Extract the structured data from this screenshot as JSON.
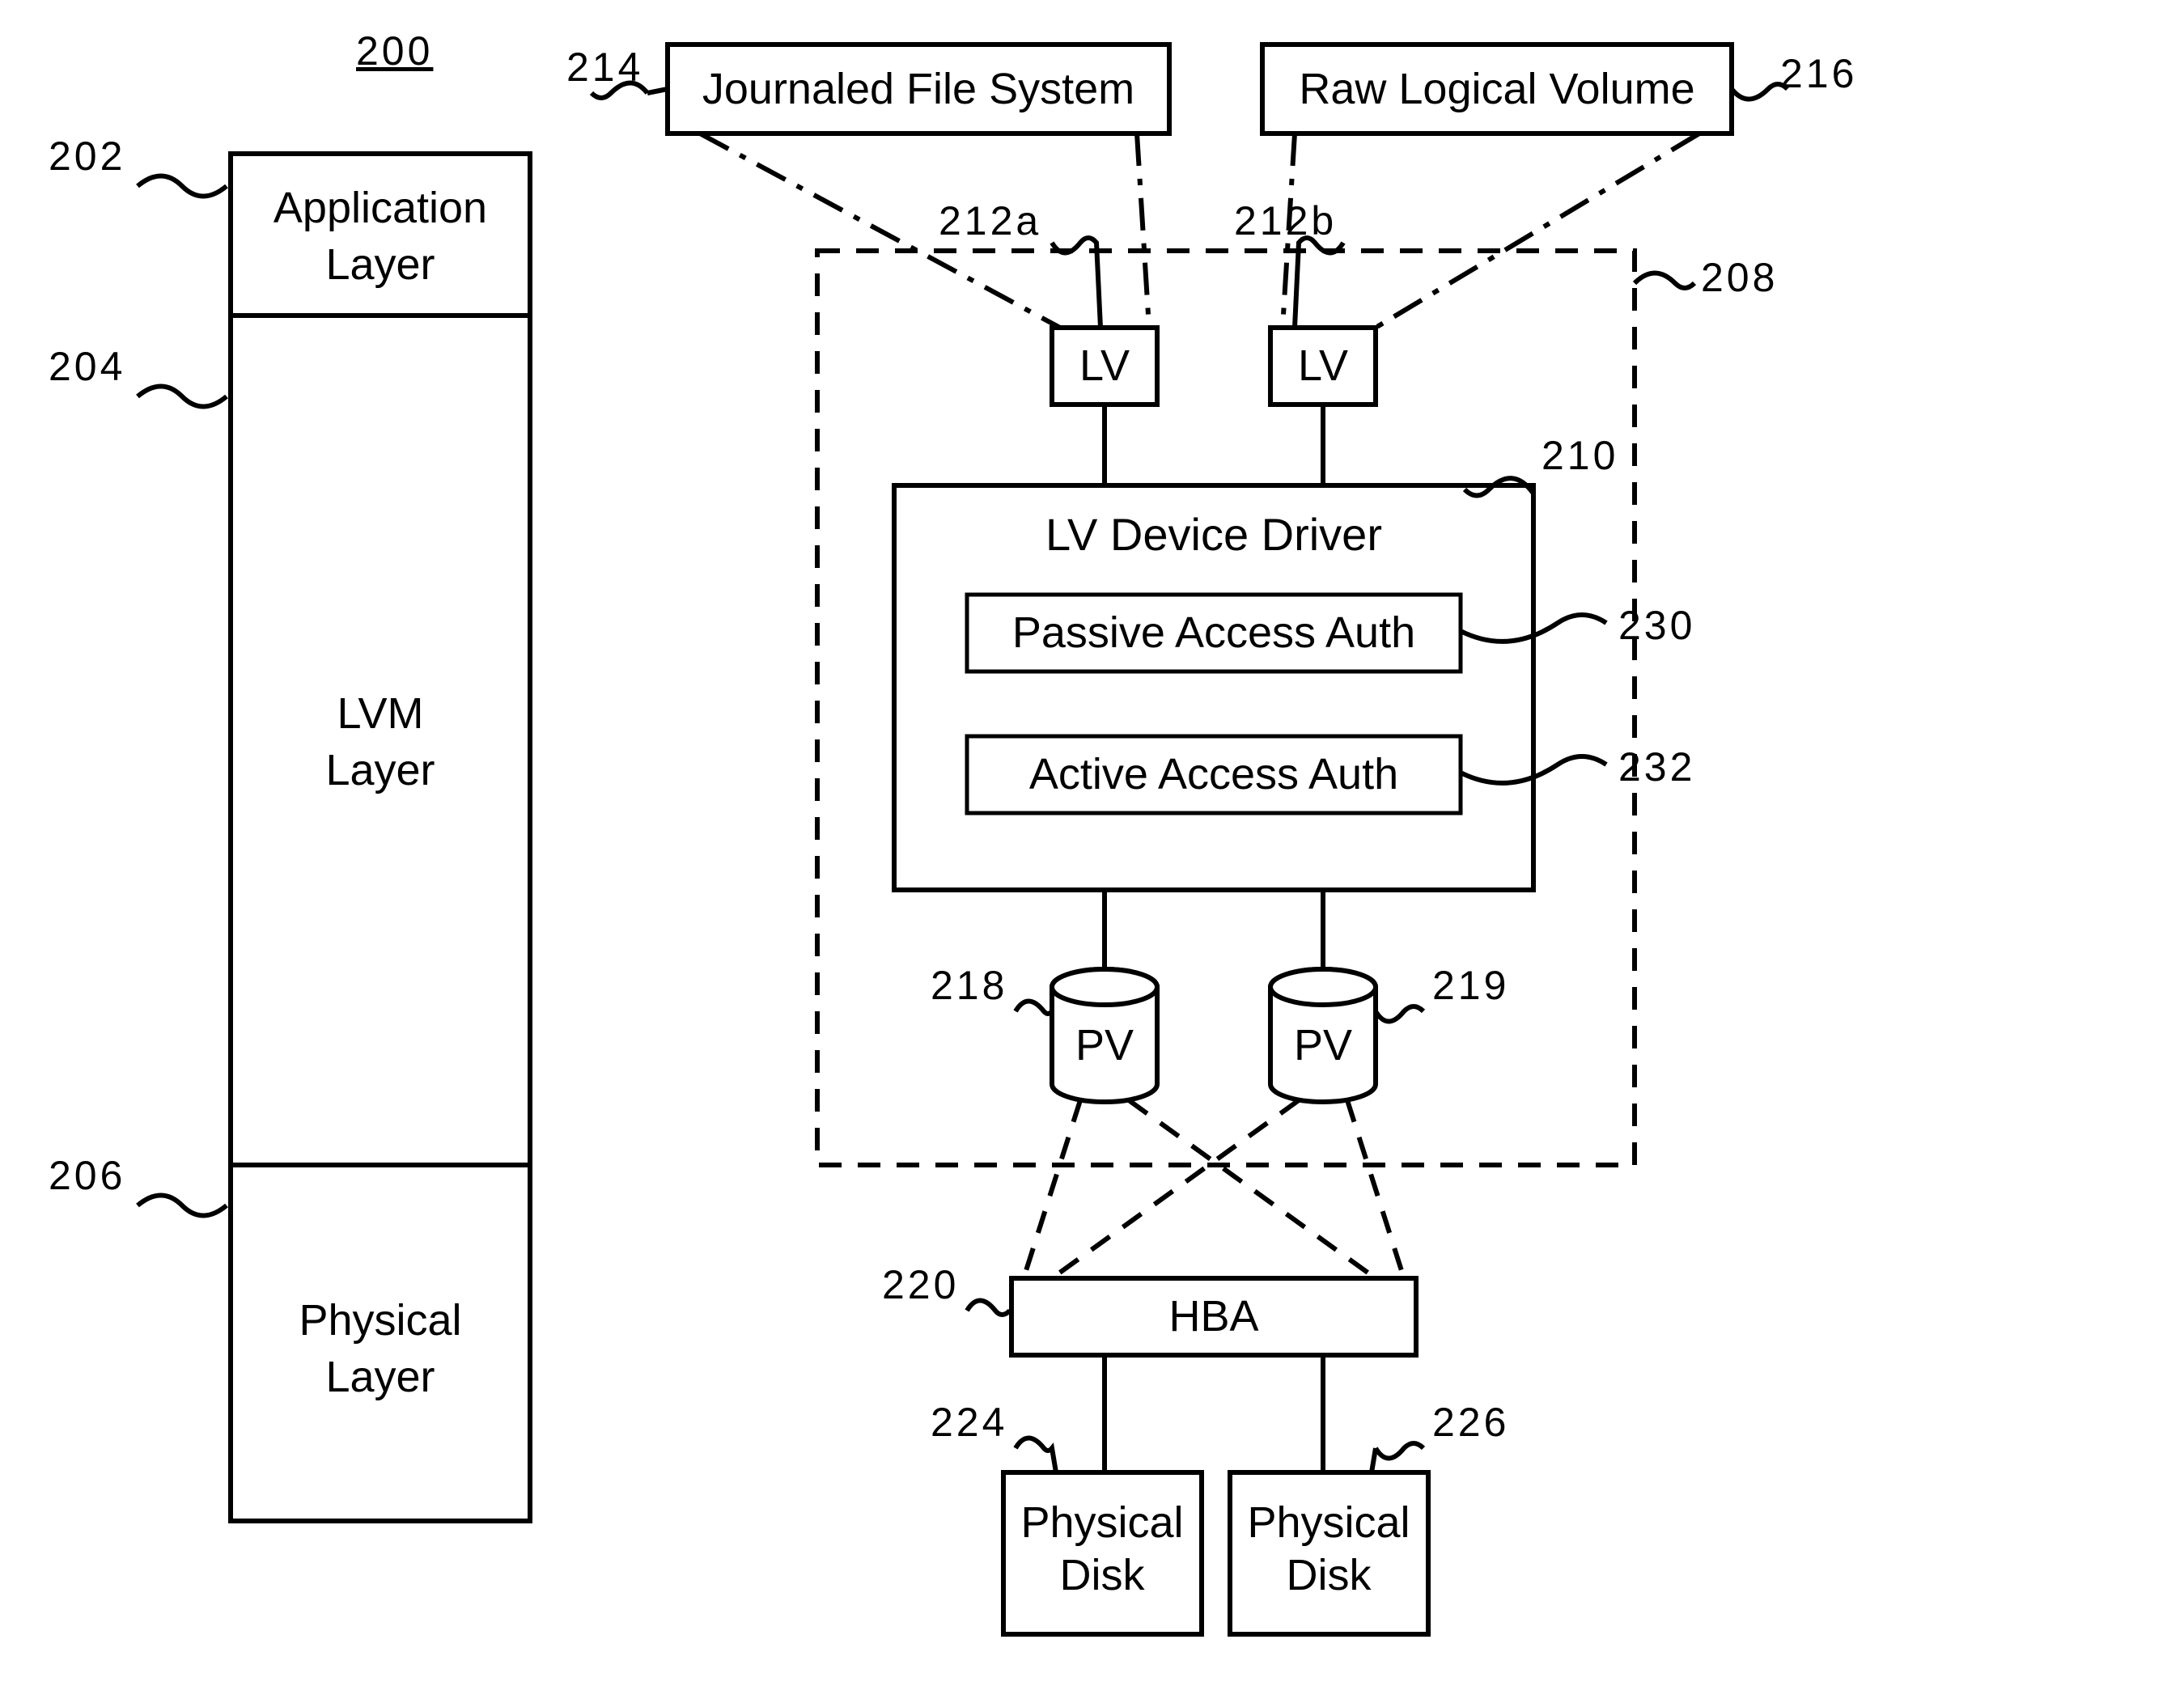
{
  "figure_ref": "200",
  "layers": {
    "application": {
      "ref": "202",
      "label_l1": "Application",
      "label_l2": "Layer"
    },
    "lvm": {
      "ref": "204",
      "label_l1": "LVM",
      "label_l2": "Layer"
    },
    "physical": {
      "ref": "206",
      "label_l1": "Physical",
      "label_l2": "Layer"
    }
  },
  "app_blocks": {
    "jfs": {
      "ref": "214",
      "label": "Journaled File System"
    },
    "rlv": {
      "ref": "216",
      "label": "Raw Logical Volume"
    }
  },
  "vg": {
    "ref": "208",
    "lv_a": {
      "ref": "212a",
      "label": "LV"
    },
    "lv_b": {
      "ref": "212b",
      "label": "LV"
    },
    "driver": {
      "ref": "210",
      "title": "LV Device Driver",
      "passive": {
        "ref": "230",
        "label": "Passive Access Auth"
      },
      "active": {
        "ref": "232",
        "label": "Active Access Auth"
      }
    },
    "pv_a": {
      "ref": "218",
      "label": "PV"
    },
    "pv_b": {
      "ref": "219",
      "label": "PV"
    }
  },
  "hba": {
    "ref": "220",
    "label": "HBA"
  },
  "disks": {
    "a": {
      "ref": "224",
      "label_l1": "Physical",
      "label_l2": "Disk"
    },
    "b": {
      "ref": "226",
      "label_l1": "Physical",
      "label_l2": "Disk"
    }
  }
}
